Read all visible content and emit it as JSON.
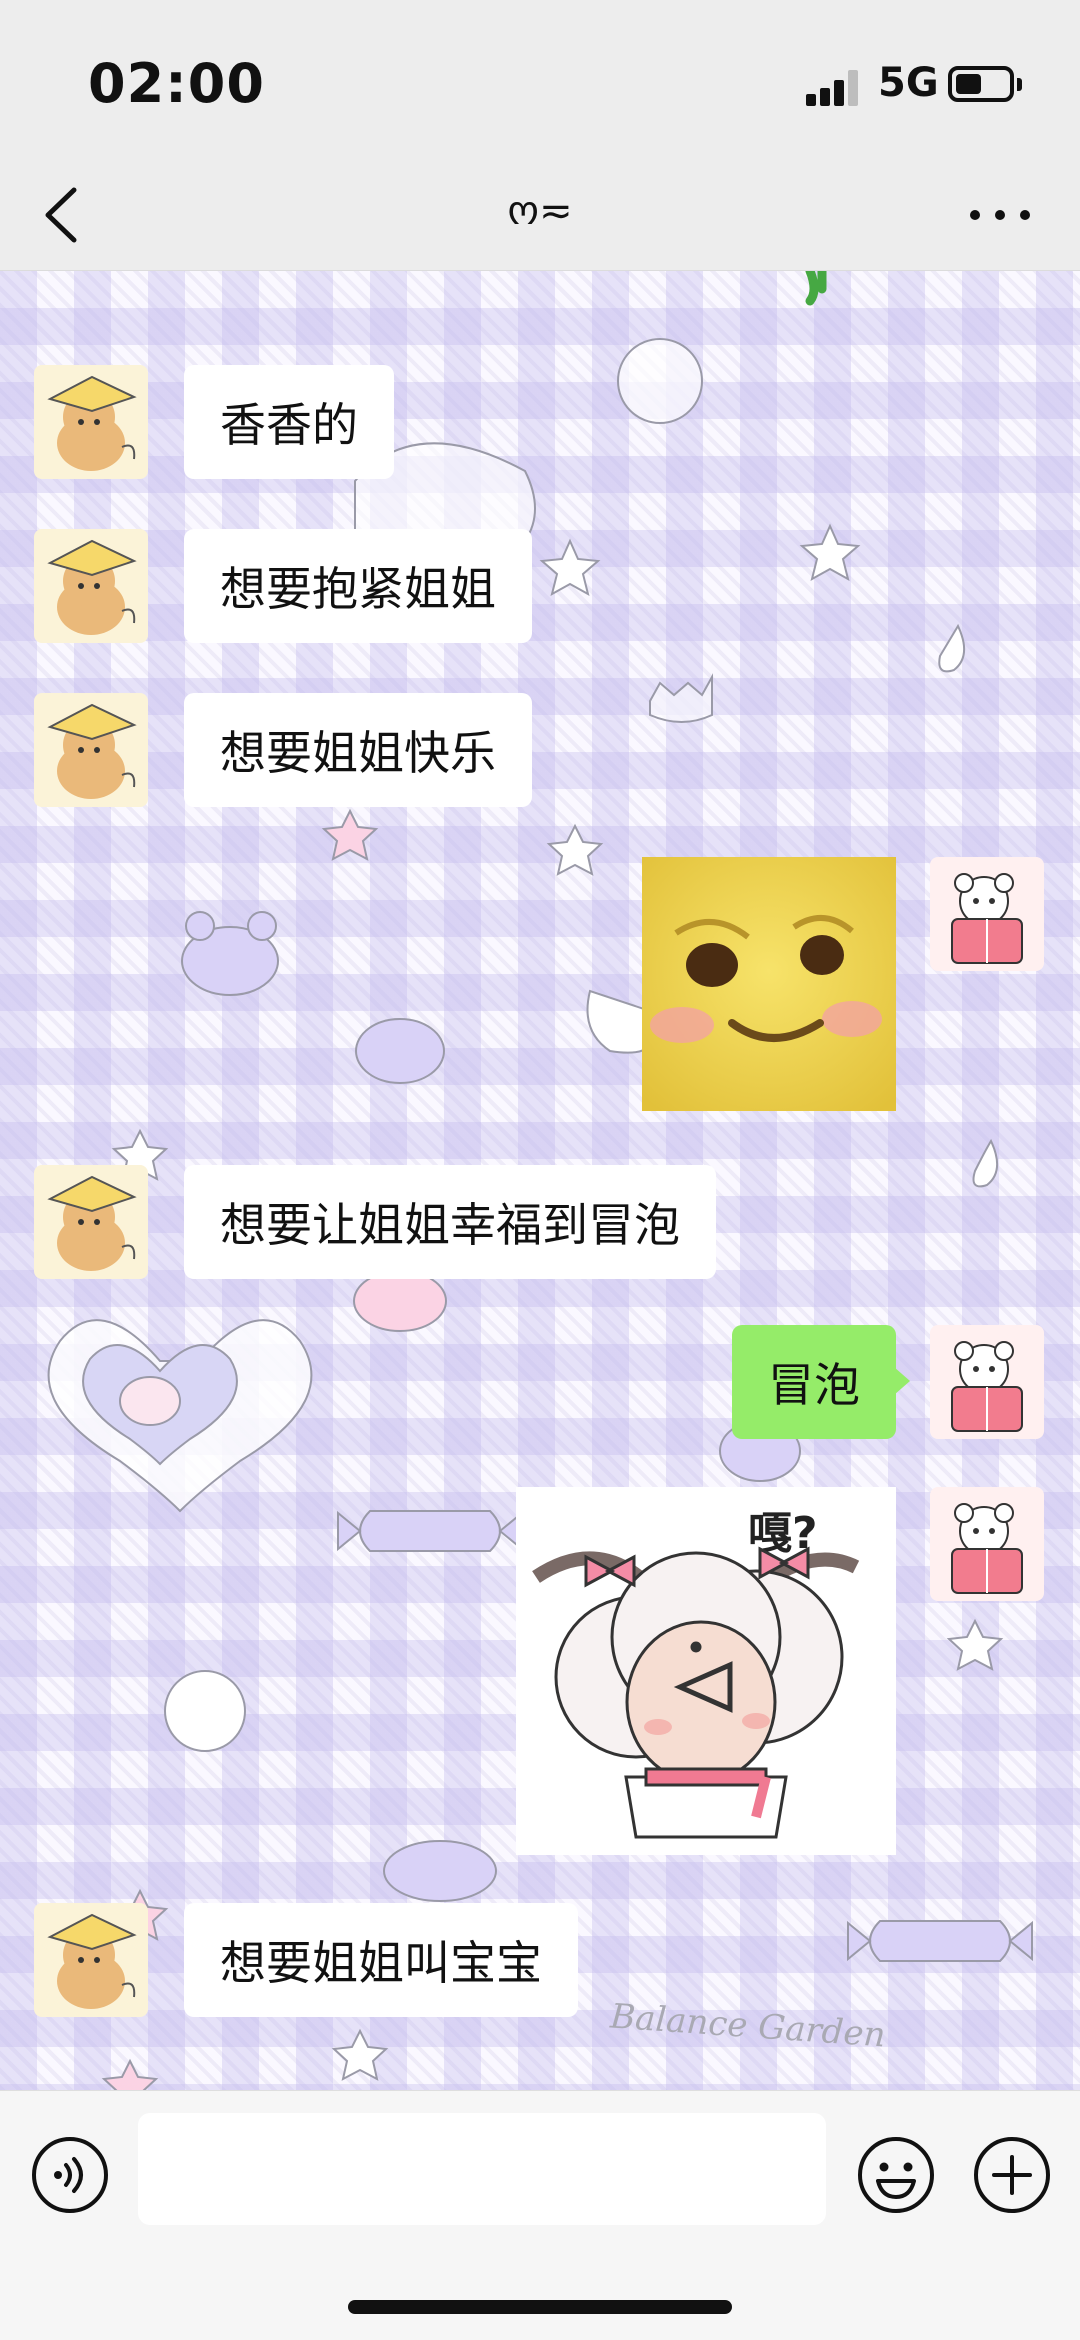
{
  "status_bar": {
    "time": "02:00",
    "network": "5G",
    "battery_level": 0.5
  },
  "nav": {
    "title": "ო≂",
    "back_icon": "chevron-left-icon",
    "more_icon": "more-dots-icon"
  },
  "messages": [
    {
      "side": "received",
      "kind": "text",
      "text": "香香的",
      "avatar": "puppy-avatar"
    },
    {
      "side": "received",
      "kind": "text",
      "text": "想要抱紧姐姐",
      "avatar": "puppy-avatar"
    },
    {
      "side": "received",
      "kind": "text",
      "text": "想要姐姐快乐",
      "avatar": "puppy-avatar"
    },
    {
      "side": "sent",
      "kind": "sticker",
      "sticker": "blushing-smile-emoji-sticker",
      "avatar": "bear-avatar"
    },
    {
      "side": "received",
      "kind": "text",
      "text": "想要让姐姐幸福到冒泡",
      "avatar": "puppy-avatar"
    },
    {
      "side": "sent",
      "kind": "text",
      "text": "冒泡",
      "avatar": "bear-avatar"
    },
    {
      "side": "sent",
      "kind": "sticker",
      "sticker": "confused-sheep-sticker",
      "sticker_caption": "嘎?",
      "avatar": "bear-avatar"
    },
    {
      "side": "received",
      "kind": "text",
      "text": "想要姐姐叫宝宝",
      "avatar": "puppy-avatar"
    }
  ],
  "background_watermark": "Balance Garden",
  "input_bar": {
    "text_value": "",
    "voice_icon": "voice-icon",
    "emoji_icon": "emoji-icon",
    "plus_icon": "plus-icon"
  },
  "colors": {
    "sent_bubble": "#95ec69",
    "received_bubble": "#ffffff",
    "bar_bg": "#ededed"
  }
}
